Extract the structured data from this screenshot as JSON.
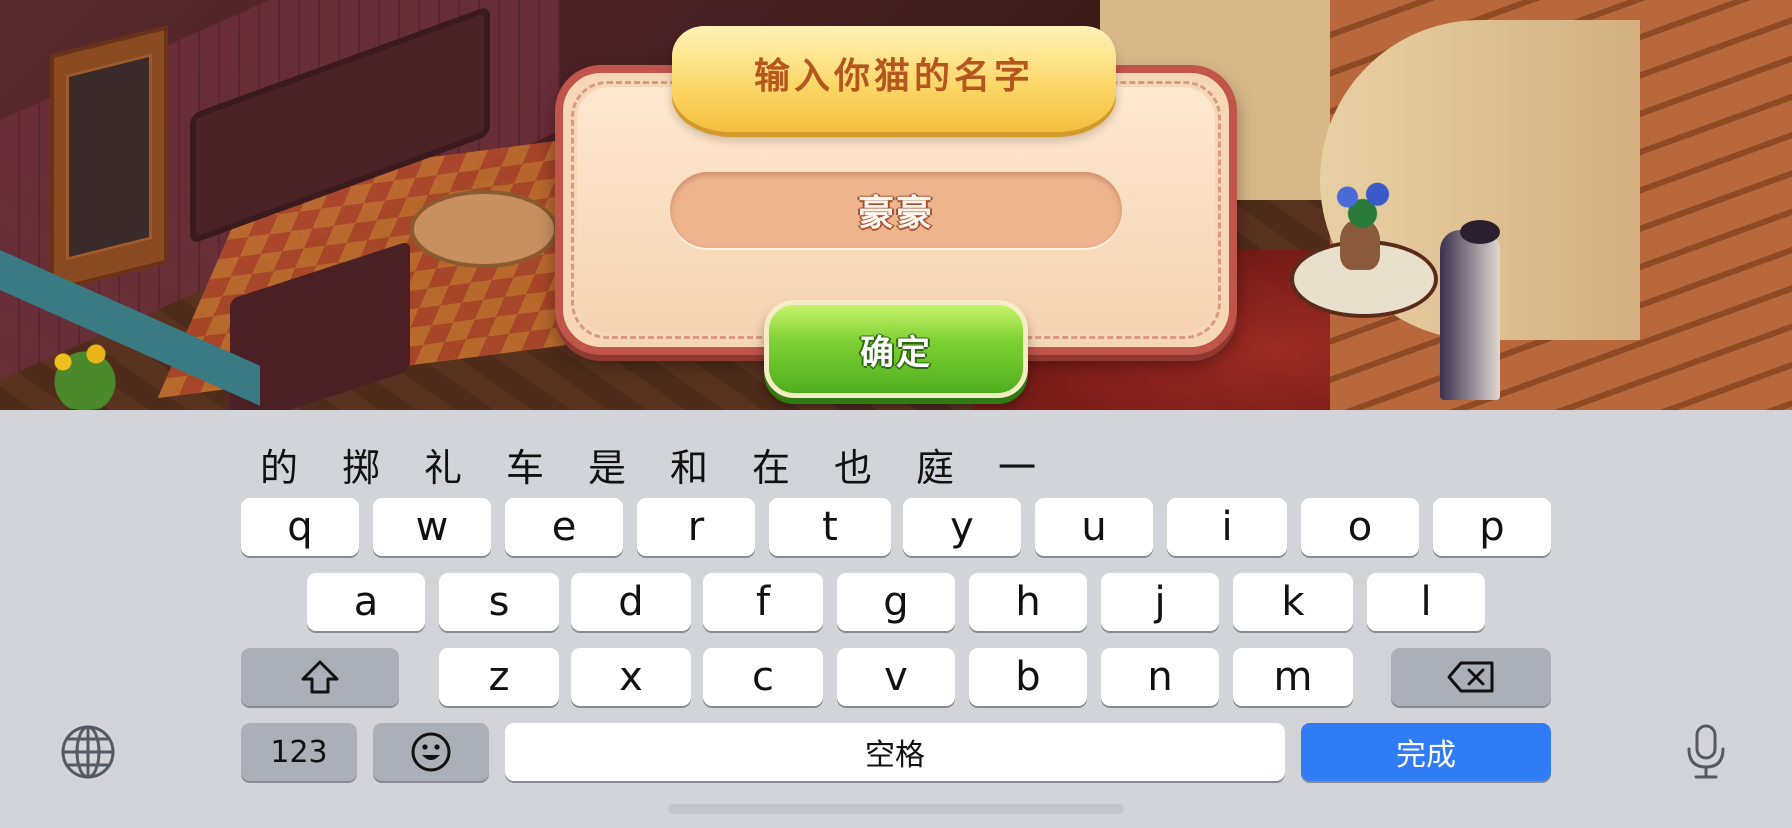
{
  "dialog": {
    "title": "输入你猫的名字",
    "name_value": "豪豪",
    "confirm_label": "确定"
  },
  "keyboard": {
    "candidates": [
      "的",
      "掷",
      "礼",
      "车",
      "是",
      "和",
      "在",
      "也",
      "庭",
      "一"
    ],
    "row1": [
      "q",
      "w",
      "e",
      "r",
      "t",
      "y",
      "u",
      "i",
      "o",
      "p"
    ],
    "row2": [
      "a",
      "s",
      "d",
      "f",
      "g",
      "h",
      "j",
      "k",
      "l"
    ],
    "row3": [
      "z",
      "x",
      "c",
      "v",
      "b",
      "n",
      "m"
    ],
    "numbers_label": "123",
    "space_label": "空格",
    "done_label": "完成",
    "icons": {
      "shift": "shift-icon",
      "delete": "backspace-icon",
      "emoji": "emoji-icon",
      "globe": "globe-icon",
      "mic": "microphone-icon"
    },
    "colors": {
      "done_key": "#2f7cf6",
      "keyboard_bg": "#d2d4da"
    }
  }
}
